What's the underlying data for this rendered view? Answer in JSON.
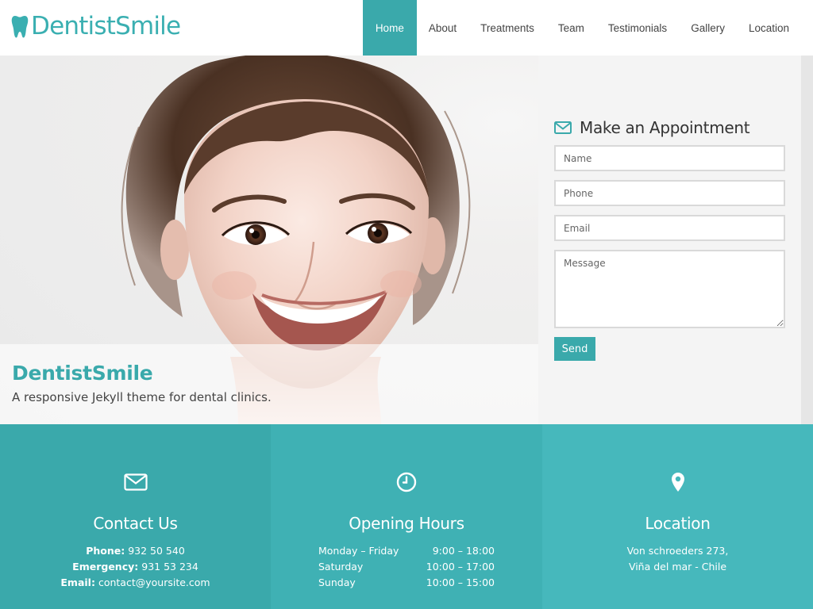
{
  "brand": {
    "name": "DentistSmile",
    "logo_icon": "tooth-icon",
    "color": "#3aafb1"
  },
  "nav": {
    "items": [
      {
        "label": "Home",
        "active": true
      },
      {
        "label": "About"
      },
      {
        "label": "Treatments"
      },
      {
        "label": "Team"
      },
      {
        "label": "Testimonials"
      },
      {
        "label": "Gallery"
      },
      {
        "label": "Location"
      }
    ],
    "accent": "#3aa9ab"
  },
  "hero": {
    "title": "DentistSmile",
    "subtitle": "A responsive Jekyll theme for dental clinics."
  },
  "appointment": {
    "title": "Make an Appointment",
    "icon": "envelope-icon",
    "fields": {
      "name_placeholder": "Name",
      "phone_placeholder": "Phone",
      "email_placeholder": "Email",
      "message_placeholder": "Message"
    },
    "send_label": "Send"
  },
  "info": {
    "contact": {
      "icon": "envelope-icon",
      "title": "Contact Us",
      "phone_label": "Phone:",
      "phone": "932 50 540",
      "emergency_label": "Emergency:",
      "emergency": "931 53 234",
      "email_label": "Email:",
      "email": "contact@yoursite.com"
    },
    "hours": {
      "icon": "clock-icon",
      "title": "Opening Hours",
      "rows": [
        {
          "day": "Monday – Friday",
          "time": "9:00 – 18:00"
        },
        {
          "day": "Saturday",
          "time": "10:00 – 17:00"
        },
        {
          "day": "Sunday",
          "time": "10:00 – 15:00"
        }
      ]
    },
    "location": {
      "icon": "map-pin-icon",
      "title": "Location",
      "line1": "Von schroeders 273,",
      "line2": "Viña del mar - Chile"
    },
    "colors": [
      "#3aa9ab",
      "#3fb1b4",
      "#46b8bc"
    ]
  }
}
